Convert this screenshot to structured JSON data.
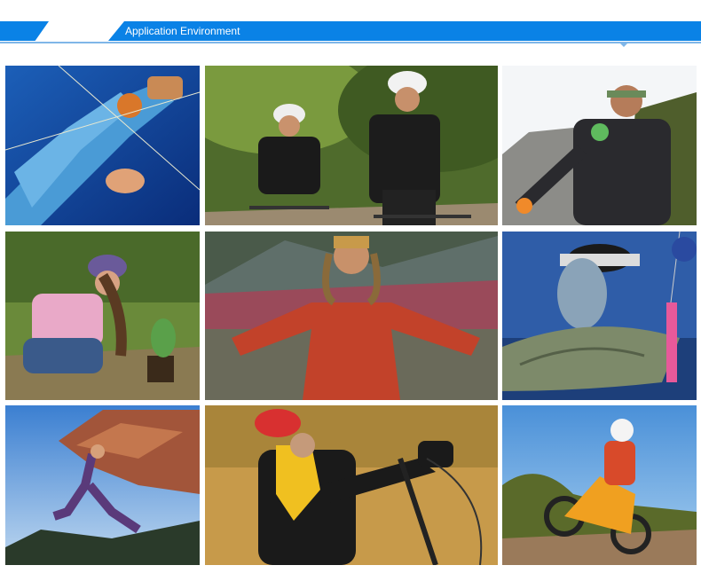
{
  "header": {
    "title": "Application Environment",
    "accent_color": "#0a82e6"
  },
  "photos": [
    {
      "name": "fishing-photo"
    },
    {
      "name": "cycling-photo"
    },
    {
      "name": "rock-climbing-photo"
    },
    {
      "name": "gardening-photo"
    },
    {
      "name": "hiking-photo"
    },
    {
      "name": "fish-catch-photo"
    },
    {
      "name": "bouldering-photo"
    },
    {
      "name": "mountain-bike-photo"
    },
    {
      "name": "motocross-photo"
    }
  ]
}
